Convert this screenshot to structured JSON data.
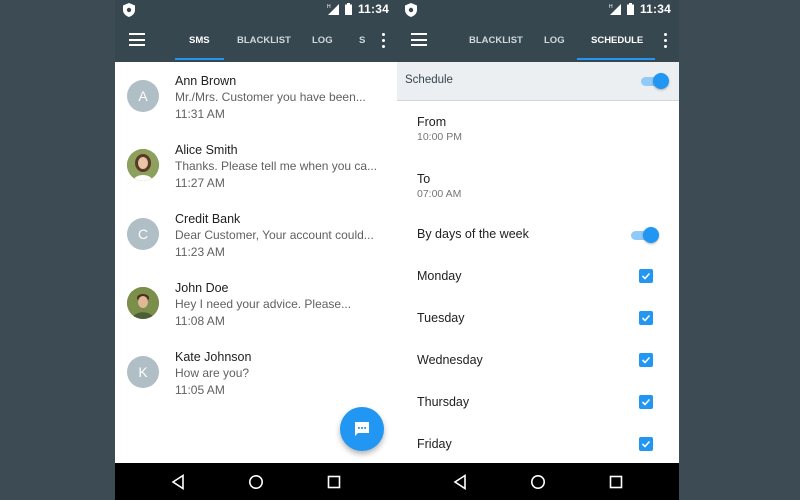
{
  "status_bar": {
    "time": "11:34"
  },
  "left_screen": {
    "tabs": [
      {
        "label": "SMS",
        "active": true
      },
      {
        "label": "BLACKLIST",
        "active": false
      },
      {
        "label": "LOG",
        "active": false
      },
      {
        "label": "S",
        "active": false
      }
    ],
    "messages": [
      {
        "avatar_letter": "A",
        "avatar": "letter",
        "name": "Ann Brown",
        "preview": "Mr./Mrs. Customer you have been...",
        "time": "11:31 AM"
      },
      {
        "avatar_letter": "",
        "avatar": "photo",
        "name": "Alice Smith",
        "preview": "Thanks. Please tell me when you ca...",
        "time": "11:27 AM"
      },
      {
        "avatar_letter": "C",
        "avatar": "letter",
        "name": "Credit Bank",
        "preview": "Dear Customer, Your account could...",
        "time": "11:23 AM"
      },
      {
        "avatar_letter": "",
        "avatar": "photo",
        "name": "John Doe",
        "preview": "Hey I need your advice. Please...",
        "time": "11:08 AM"
      },
      {
        "avatar_letter": "K",
        "avatar": "letter",
        "name": "Kate Johnson",
        "preview": "How are you?",
        "time": "11:05 AM"
      }
    ],
    "fab_icon": "chat-icon"
  },
  "right_screen": {
    "tabs": [
      {
        "label": "BLACKLIST",
        "active": false
      },
      {
        "label": "LOG",
        "active": false
      },
      {
        "label": "SCHEDULE",
        "active": true
      }
    ],
    "schedule_label": "Schedule",
    "schedule_enabled": true,
    "from": {
      "label": "From",
      "value": "10:00 PM"
    },
    "to": {
      "label": "To",
      "value": "07:00 AM"
    },
    "by_days_label": "By days of the week",
    "by_days_enabled": true,
    "days": [
      {
        "label": "Monday",
        "checked": true
      },
      {
        "label": "Tuesday",
        "checked": true
      },
      {
        "label": "Wednesday",
        "checked": true
      },
      {
        "label": "Thursday",
        "checked": true
      },
      {
        "label": "Friday",
        "checked": true
      }
    ]
  },
  "colors": {
    "accent": "#2196f3",
    "app_bar": "#37474f",
    "background": "#3d4b55"
  }
}
